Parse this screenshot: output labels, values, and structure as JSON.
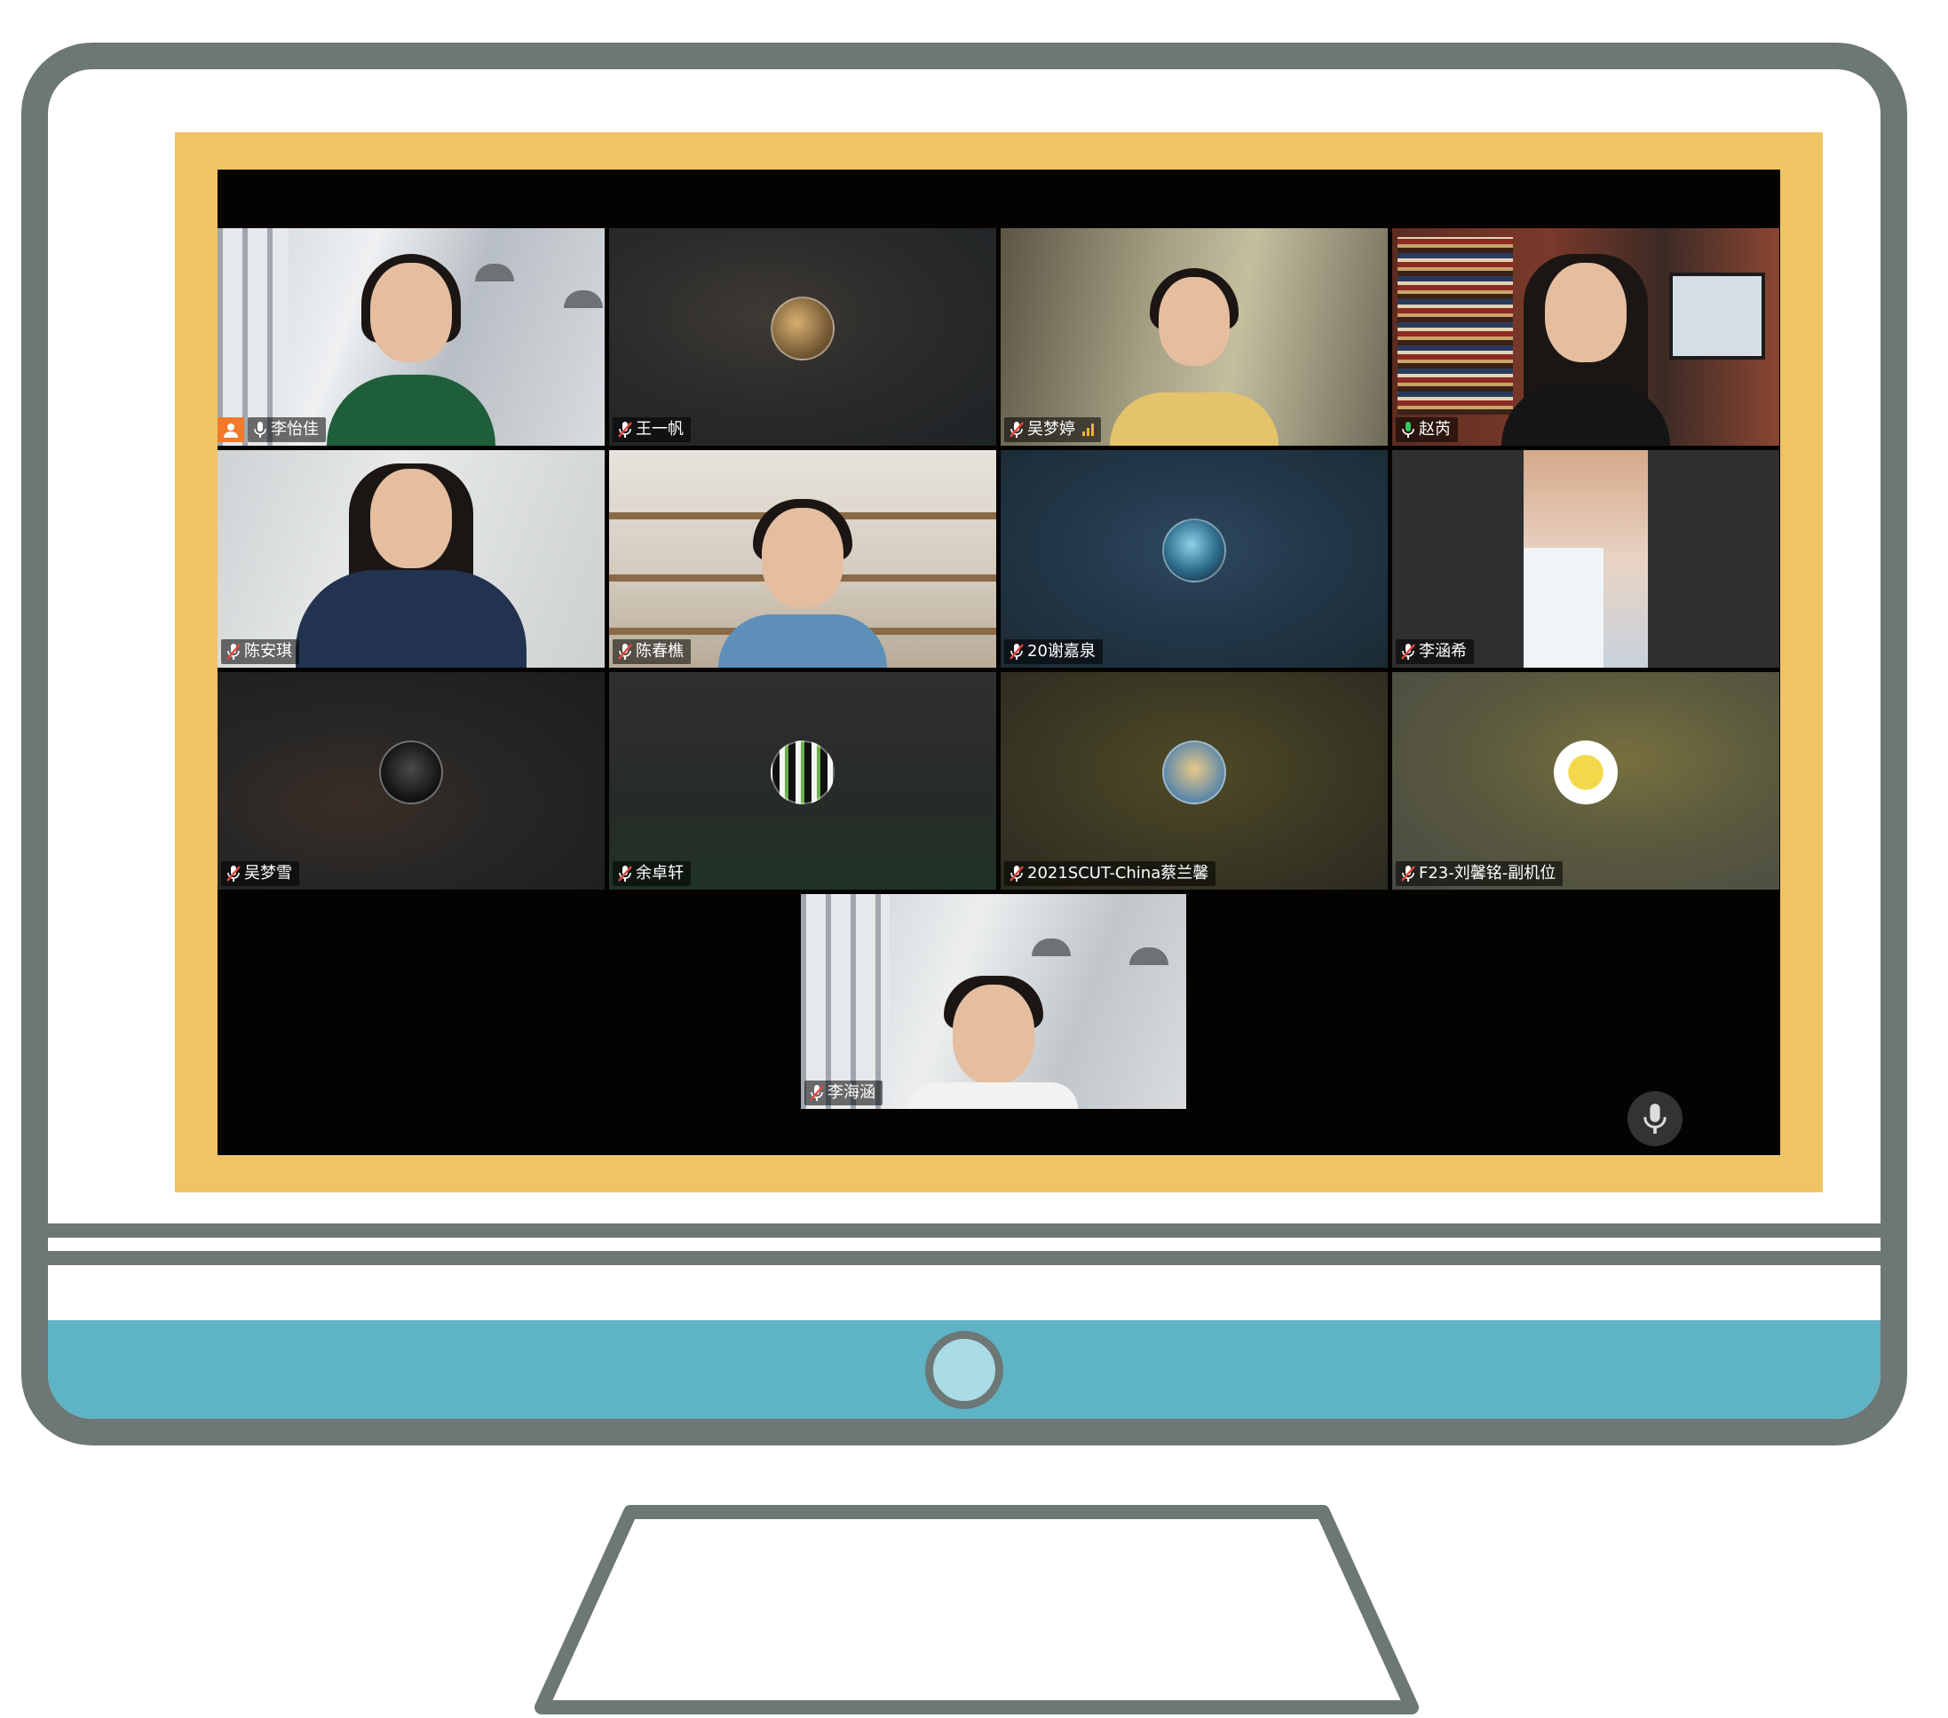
{
  "meeting": {
    "participants": [
      {
        "name": "李怡佳",
        "has_video": true,
        "host": true,
        "active_speaker": false
      },
      {
        "name": "王一帆",
        "has_video": false,
        "host": false,
        "active_speaker": false
      },
      {
        "name": "吴梦婷",
        "has_video": true,
        "host": false,
        "active_speaker": false,
        "signal": "weak"
      },
      {
        "name": "赵芮",
        "has_video": true,
        "host": false,
        "active_speaker": true
      },
      {
        "name": "陈安琪",
        "has_video": true,
        "host": false,
        "active_speaker": false
      },
      {
        "name": "陈春樵",
        "has_video": true,
        "host": false,
        "active_speaker": false
      },
      {
        "name": "20谢嘉泉",
        "has_video": false,
        "host": false,
        "active_speaker": false
      },
      {
        "name": "李涵希",
        "has_video": true,
        "host": false,
        "active_speaker": false
      },
      {
        "name": "吴梦雪",
        "has_video": false,
        "host": false,
        "active_speaker": false
      },
      {
        "name": "余卓轩",
        "has_video": false,
        "host": false,
        "active_speaker": false
      },
      {
        "name": "2021SCUT-China蔡兰馨",
        "has_video": false,
        "host": false,
        "active_speaker": false
      },
      {
        "name": "F23-刘馨铭-副机位",
        "has_video": false,
        "host": false,
        "active_speaker": false
      }
    ],
    "self": {
      "name": "李海涵",
      "has_video": true
    },
    "colors": {
      "monitor_frame": "#6c7776",
      "screen_border": "#efc467",
      "chin": "#5eb3c4",
      "active_speaker": "#31c85c",
      "host_badge": "#f27a2a",
      "muted_mic": "#e8453c"
    },
    "icons": [
      "microphone-muted-icon",
      "microphone-icon",
      "host-icon",
      "signal-strength-icon",
      "mic-toggle-icon",
      "power-button-icon"
    ]
  }
}
